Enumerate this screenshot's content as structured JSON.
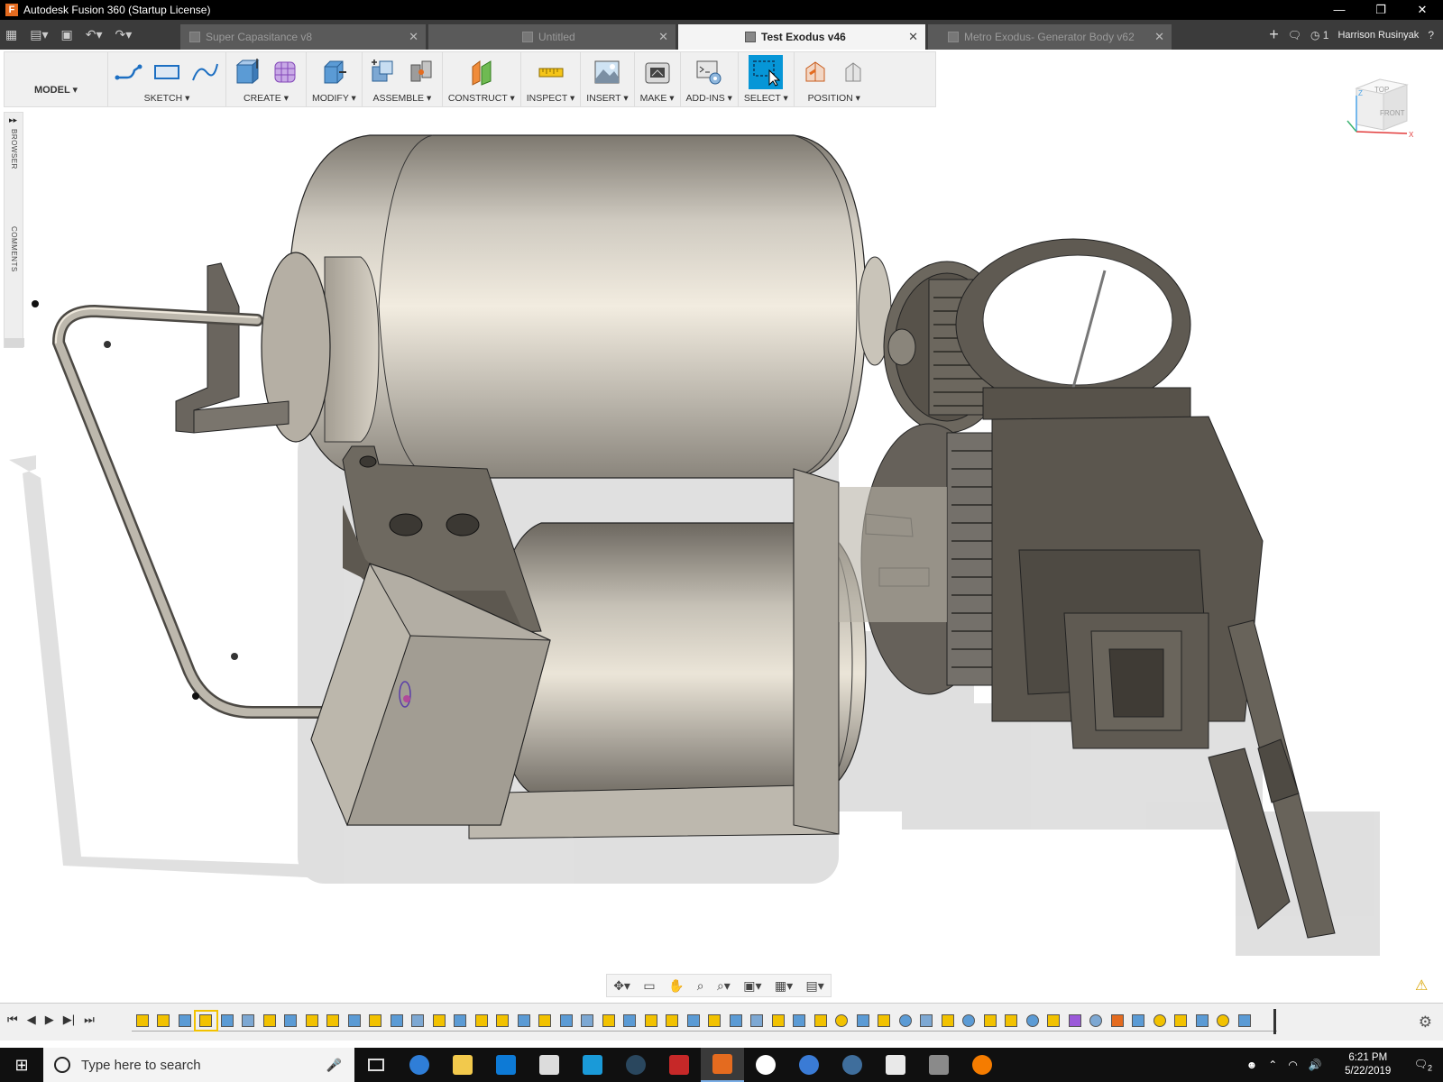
{
  "window": {
    "title": "Autodesk Fusion 360 (Startup License)",
    "app_letter": "F"
  },
  "window_controls": {
    "minimize": "—",
    "restore": "❐",
    "close": "✕"
  },
  "tabs": [
    {
      "label": "Super Capasitance v8",
      "active": false
    },
    {
      "label": "Untitled",
      "active": false
    },
    {
      "label": "Test Exodus v46",
      "active": true
    },
    {
      "label": "Metro Exodus- Generator Body v62",
      "active": false
    }
  ],
  "header_right": {
    "new_tab": "+",
    "jobs_count": "1",
    "user": "Harrison Rusinyak"
  },
  "toolbar": {
    "workspace": "MODEL",
    "groups": [
      "SKETCH",
      "CREATE",
      "MODIFY",
      "ASSEMBLE",
      "CONSTRUCT",
      "INSPECT",
      "INSERT",
      "MAKE",
      "ADD-INS",
      "SELECT",
      "POSITION"
    ]
  },
  "viewcube": {
    "top": "TOP",
    "front": "FRONT",
    "axis_x": "X",
    "axis_z": "Z"
  },
  "browser_panel": {
    "browser_label": "BROWSER",
    "comments_label": "COMMENTS"
  },
  "timeline": {
    "feature_count": 53
  },
  "taskbar": {
    "search_placeholder": "Type here to search",
    "time": "6:21 PM",
    "date": "5/22/2019",
    "notification_count": "2"
  },
  "colors": {
    "accent_blue": "#0696d7",
    "timeline_yellow": "#f2c200",
    "titlebar": "#000000",
    "tabbar": "#3b3b3b"
  }
}
